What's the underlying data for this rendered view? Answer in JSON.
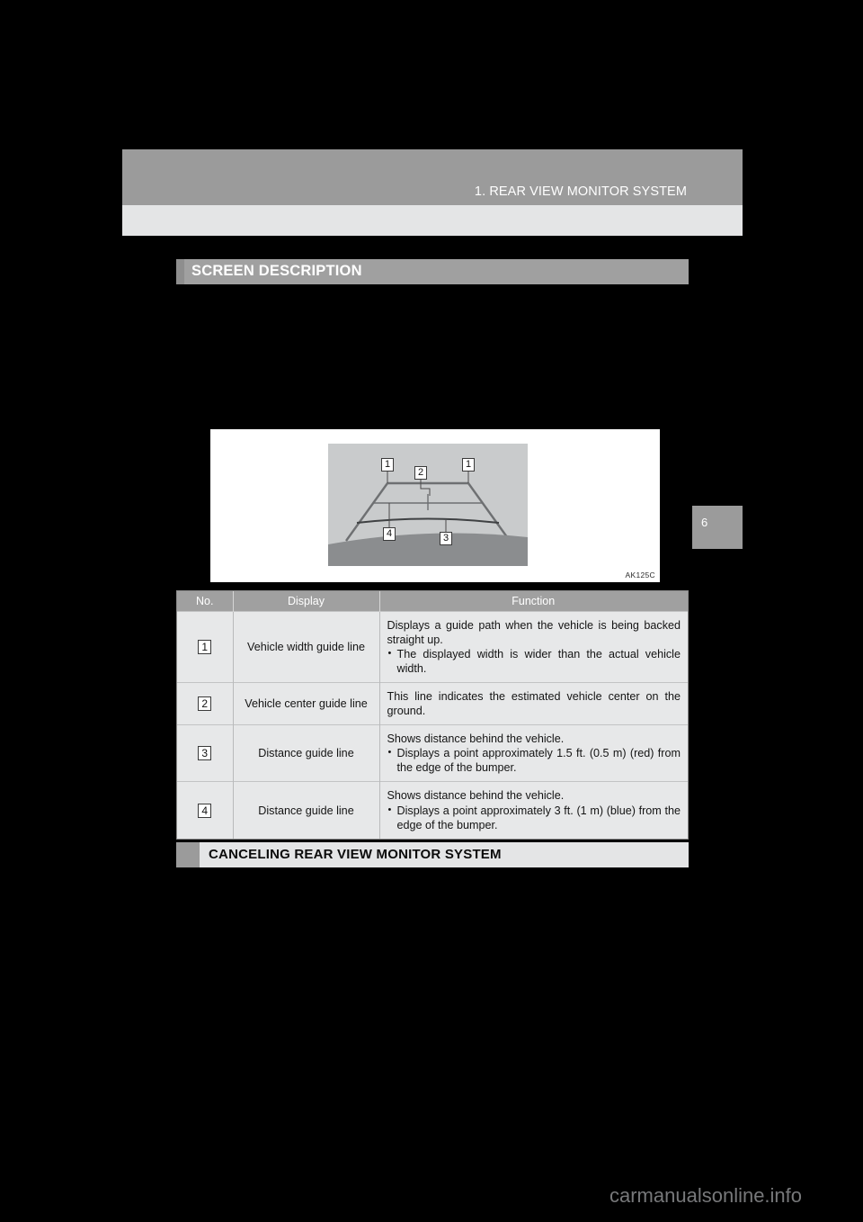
{
  "header": {
    "running_title": "1. REAR VIEW MONITOR SYSTEM",
    "page_number": "6"
  },
  "section": {
    "title": "SCREEN DESCRIPTION"
  },
  "figure": {
    "code": "AK125C",
    "callouts": [
      "1",
      "1",
      "2",
      "4",
      "3"
    ]
  },
  "table": {
    "columns": [
      "No.",
      "Display",
      "Function"
    ],
    "rows": [
      {
        "no": "1",
        "display": "Vehicle width guide line",
        "function_main": "Displays a guide path when the vehicle is being backed straight up.",
        "function_bullet": "The displayed width is wider than the actual vehicle width."
      },
      {
        "no": "2",
        "display": "Vehicle center guide line",
        "function_main": "This line indicates the estimated vehicle center on the ground.",
        "function_bullet": ""
      },
      {
        "no": "3",
        "display": "Distance guide line",
        "function_main": "Shows distance behind the vehicle.",
        "function_bullet": "Displays a point approximately 1.5 ft. (0.5 m) (red) from the edge of the bumper."
      },
      {
        "no": "4",
        "display": "Distance guide line",
        "function_main": "Shows distance behind the vehicle.",
        "function_bullet": "Displays a point approximately 3 ft. (1 m) (blue) from the edge of the bumper."
      }
    ]
  },
  "subsection": {
    "title": "CANCELING REAR VIEW MONITOR SYSTEM"
  },
  "watermark": {
    "text": "carmanualsonline.info"
  },
  "colors": {
    "header_band": "#9b9b9b",
    "header_subband": "#e4e5e6",
    "section_bar": "#a0a0a0",
    "table_header": "#a0a0a0",
    "table_cell": "#e7e8e9",
    "camera_sky": "#c9cbcc",
    "camera_ground": "#8b8d8f",
    "page_background": "#000000"
  }
}
